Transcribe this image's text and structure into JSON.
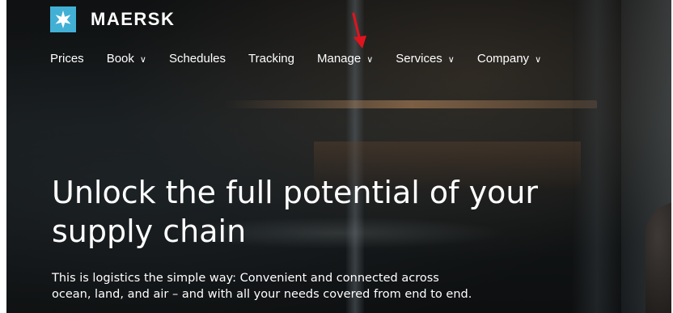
{
  "brand": {
    "name": "MAERSK",
    "logo_icon": "seven-point-star-icon",
    "logo_color": "#42b0d5"
  },
  "nav": {
    "items": [
      {
        "label": "Prices",
        "has_dropdown": false
      },
      {
        "label": "Book",
        "has_dropdown": true
      },
      {
        "label": "Schedules",
        "has_dropdown": false
      },
      {
        "label": "Tracking",
        "has_dropdown": false
      },
      {
        "label": "Manage",
        "has_dropdown": true
      },
      {
        "label": "Services",
        "has_dropdown": true
      },
      {
        "label": "Company",
        "has_dropdown": true
      }
    ],
    "chevron": "∨"
  },
  "annotation": {
    "arrow_color": "#e0141e",
    "points_to": "Manage"
  },
  "hero": {
    "headline_line1": "Unlock the full potential of your",
    "headline_line2": "supply chain",
    "subtext_line1": "This is logistics the simple way: Convenient and connected across",
    "subtext_line2": "ocean, land, and air – and with all your needs covered from end to end."
  }
}
